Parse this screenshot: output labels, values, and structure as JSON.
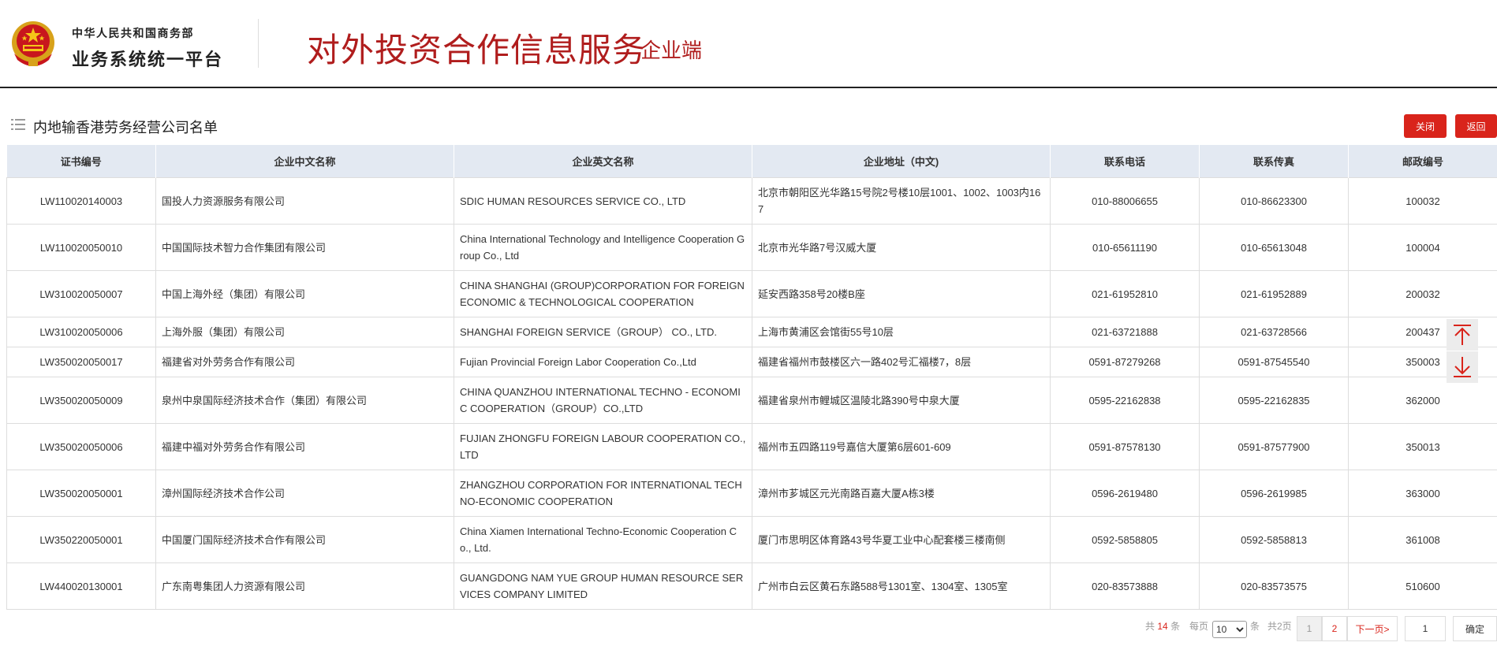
{
  "header": {
    "ministry": "中华人民共和国商务部",
    "platform": "业务系统统一平台",
    "service_title": "对外投资合作信息服务",
    "service_sub": "企业端"
  },
  "section": {
    "title": "内地输香港劳务经营公司名单",
    "close_label": "关闭",
    "back_label": "返回"
  },
  "table": {
    "columns": [
      "证书编号",
      "企业中文名称",
      "企业英文名称",
      "企业地址（中文)",
      "联系电话",
      "联系传真",
      "邮政编号"
    ],
    "rows": [
      [
        "LW110020140003",
        "国投人力资源服务有限公司",
        "SDIC HUMAN RESOURCES SERVICE CO., LTD",
        "北京市朝阳区光华路15号院2号楼10层1001、1002、1003内167",
        "010-88006655",
        "010-86623300",
        "100032"
      ],
      [
        "LW110020050010",
        "中国国际技术智力合作集团有限公司",
        "China International Technology and Intelligence Cooperation Group Co., Ltd",
        "北京市光华路7号汉威大厦",
        "010-65611190",
        "010-65613048",
        "100004"
      ],
      [
        "LW310020050007",
        "中国上海外经（集团）有限公司",
        "CHINA SHANGHAI (GROUP)CORPORATION FOR FOREIGN ECONOMIC & TECHNOLOGICAL COOPERATION",
        "延安西路358号20楼B座",
        "021-61952810",
        "021-61952889",
        "200032"
      ],
      [
        "LW310020050006",
        "上海外服（集团）有限公司",
        "SHANGHAI FOREIGN SERVICE（GROUP） CO., LTD.",
        "上海市黄浦区会馆街55号10层",
        "021-63721888",
        "021-63728566",
        "200437"
      ],
      [
        "LW350020050017",
        "福建省对外劳务合作有限公司",
        "Fujian Provincial Foreign Labor Cooperation Co.,Ltd",
        "福建省福州市鼓楼区六一路402号汇福楼7，8层",
        "0591-87279268",
        "0591-87545540",
        "350003"
      ],
      [
        "LW350020050009",
        "泉州中泉国际经济技术合作（集团）有限公司",
        "CHINA QUANZHOU INTERNATIONAL TECHNO - ECONOMIC COOPERATION（GROUP）CO.,LTD",
        "福建省泉州市鲤城区温陵北路390号中泉大厦",
        "0595-22162838",
        "0595-22162835",
        "362000"
      ],
      [
        "LW350020050006",
        "福建中福对外劳务合作有限公司",
        "FUJIAN ZHONGFU FOREIGN LABOUR COOPERATION CO.,LTD",
        "福州市五四路119号嘉信大厦第6层601-609",
        "0591-87578130",
        "0591-87577900",
        "350013"
      ],
      [
        "LW350020050001",
        "漳州国际经济技术合作公司",
        "ZHANGZHOU CORPORATION FOR INTERNATIONAL TECHNO-ECONOMIC COOPERATION",
        "漳州市芗城区元光南路百嘉大厦A栋3楼",
        "0596-2619480",
        "0596-2619985",
        "363000"
      ],
      [
        "LW350220050001",
        "中国厦门国际经济技术合作有限公司",
        "China Xiamen International Techno-Economic Cooperation Co., Ltd.",
        "厦门市思明区体育路43号华夏工业中心配套楼三楼南侧",
        "0592-5858805",
        "0592-5858813",
        "361008"
      ],
      [
        "LW440020130001",
        "广东南粤集团人力资源有限公司",
        "GUANGDONG NAM YUE GROUP HUMAN RESOURCE SERVICES COMPANY LIMITED",
        "广州市白云区黄石东路588号1301室、1304室、1305室",
        "020-83573888",
        "020-83573575",
        "510600"
      ]
    ]
  },
  "pagination": {
    "total_prefix": "共",
    "total_count": "14",
    "total_suffix": "条",
    "per_page_label": "每页",
    "per_page_value": "10",
    "per_page_unit": "条",
    "pages_total": "共2页",
    "page1": "1",
    "page2": "2",
    "next": "下一页>",
    "goto_value": "1",
    "confirm": "确定"
  },
  "colors": {
    "brand_red": "#b01d1d",
    "button_red": "#d9241b",
    "header_bg": "#e3e9f2"
  },
  "icons": [
    "national-emblem-icon",
    "list-icon",
    "arrow-up-icon",
    "arrow-down-icon"
  ]
}
